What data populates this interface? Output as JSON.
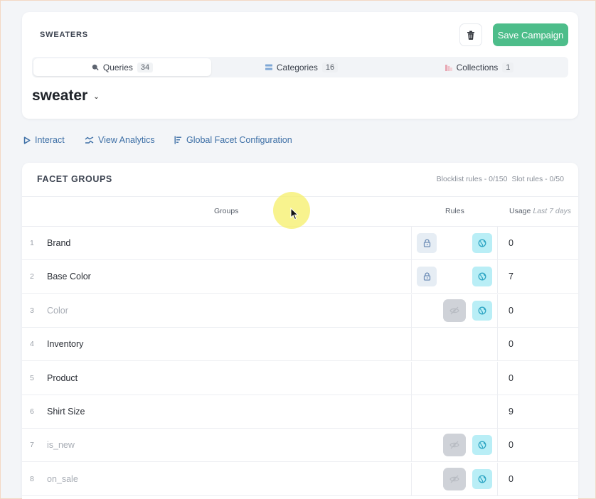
{
  "campaign": {
    "title": "SWEATERS",
    "save_label": "Save Campaign",
    "query": "sweater"
  },
  "tabs": [
    {
      "label": "Queries",
      "count": "34",
      "icon": "search-icon",
      "active": true
    },
    {
      "label": "Categories",
      "count": "16",
      "icon": "list-icon",
      "active": false
    },
    {
      "label": "Collections",
      "count": "1",
      "icon": "collection-icon",
      "active": false
    }
  ],
  "actions": {
    "interact": "Interact",
    "analytics": "View Analytics",
    "facet_config": "Global Facet Configuration"
  },
  "facets": {
    "title": "FACET GROUPS",
    "blocklist": "Blocklist rules - 0/150",
    "slot": "Slot rules - 0/50",
    "columns": {
      "groups": "Groups",
      "rules": "Rules",
      "usage": "Usage",
      "usage_sub": "Last 7 days"
    },
    "rows": [
      {
        "index": "1",
        "name": "Brand",
        "usage": "0",
        "rules": [
          "lock",
          "globe"
        ],
        "muted": false
      },
      {
        "index": "2",
        "name": "Base Color",
        "usage": "7",
        "rules": [
          "lock",
          "globe"
        ],
        "muted": false
      },
      {
        "index": "3",
        "name": "Color",
        "usage": "0",
        "rules": [
          "hide",
          "globe"
        ],
        "muted": true
      },
      {
        "index": "4",
        "name": "Inventory",
        "usage": "0",
        "rules": [],
        "muted": false
      },
      {
        "index": "5",
        "name": "Product",
        "usage": "0",
        "rules": [],
        "muted": false
      },
      {
        "index": "6",
        "name": "Shirt Size",
        "usage": "9",
        "rules": [],
        "muted": false
      },
      {
        "index": "7",
        "name": "is_new",
        "usage": "0",
        "rules": [
          "hide",
          "globe"
        ],
        "muted": true
      },
      {
        "index": "8",
        "name": "on_sale",
        "usage": "0",
        "rules": [
          "hide",
          "globe"
        ],
        "muted": true
      }
    ]
  },
  "colors": {
    "accent_green": "#4dbd8a",
    "link_blue": "#3d6fa6",
    "globe_bg": "#b9eef6",
    "lock_bg": "#e6edf4",
    "hide_bg": "#cfd2d8"
  }
}
